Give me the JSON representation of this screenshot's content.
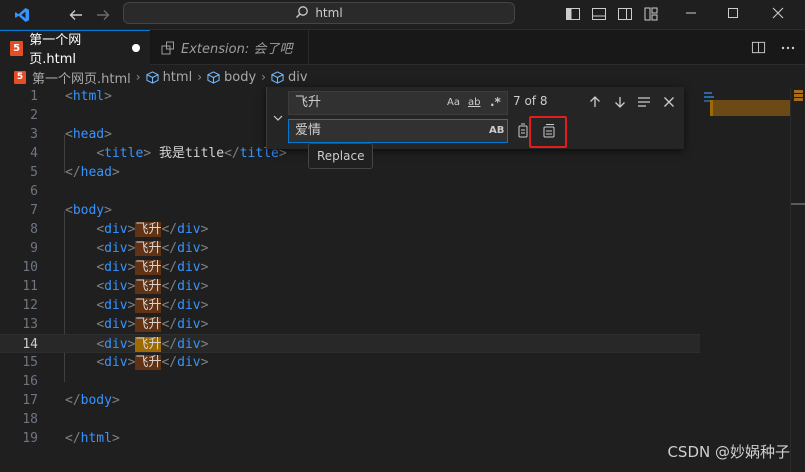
{
  "titlebar": {
    "search_text": "html",
    "search_icon": "search-icon",
    "back_icon": "arrow-left-icon",
    "forward_icon": "arrow-right-icon"
  },
  "tabs": [
    {
      "label": "第一个网页.html",
      "icon": "html5-icon",
      "dirty": true,
      "active": true
    },
    {
      "label": "Extension: 会了吧",
      "icon": "extension-icon",
      "active": false
    }
  ],
  "breadcrumb": [
    "第一个网页.html",
    "html",
    "body",
    "div"
  ],
  "editor": {
    "lines": [
      "1",
      "2",
      "3",
      "4",
      "5",
      "6",
      "7",
      "8",
      "9",
      "10",
      "11",
      "12",
      "13",
      "14",
      "15",
      "16",
      "17",
      "18",
      "19"
    ],
    "current_line": 14,
    "title_text": "我是title",
    "match_text": "飞升"
  },
  "find": {
    "find_value": "飞升",
    "replace_value": "爱情",
    "match_count": "7 of 8",
    "opt_case": "Aa",
    "opt_word": "ab",
    "opt_regex": ".*",
    "opt_preserve_case": "AB",
    "tooltip": "Replace"
  },
  "colors": {
    "accent": "#0078d4",
    "match_bg": "#613214",
    "current_match_bg": "#9e6a03",
    "highlight_border": "#e11d1d",
    "tag": "#3794ff"
  },
  "watermark": "CSDN @妙娲种子"
}
